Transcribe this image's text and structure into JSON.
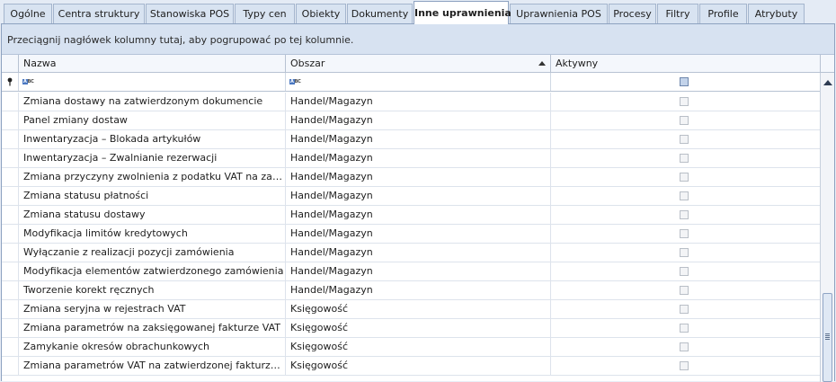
{
  "tabs": [
    {
      "label": "Ogólne",
      "active": false
    },
    {
      "label": "Centra struktury",
      "active": false
    },
    {
      "label": "Stanowiska POS",
      "active": false
    },
    {
      "label": "Typy cen",
      "active": false
    },
    {
      "label": "Obiekty",
      "active": false
    },
    {
      "label": "Dokumenty",
      "active": false
    },
    {
      "label": "Inne uprawnienia",
      "active": true
    },
    {
      "label": "Uprawnienia POS",
      "active": false
    },
    {
      "label": "Procesy",
      "active": false
    },
    {
      "label": "Filtry",
      "active": false
    },
    {
      "label": "Profile",
      "active": false
    },
    {
      "label": "Atrybuty",
      "active": false
    }
  ],
  "group_panel_text": "Przeciągnij nagłówek kolumny tutaj, aby pogrupować po tej kolumnie.",
  "columns": {
    "name": "Nazwa",
    "area": "Obszar",
    "active": "Aktywny"
  },
  "filter_icon_text": "ABC",
  "rows": [
    {
      "name": "Zmiana dostawy na zatwierdzonym dokumencie",
      "area": "Handel/Magazyn",
      "active": false
    },
    {
      "name": "Panel zmiany dostaw",
      "area": "Handel/Magazyn",
      "active": false
    },
    {
      "name": "Inwentaryzacja – Blokada artykułów",
      "area": "Handel/Magazyn",
      "active": false
    },
    {
      "name": "Inwentaryzacja – Zwalnianie rezerwacji",
      "area": "Handel/Magazyn",
      "active": false
    },
    {
      "name": "Zmiana przyczyny zwolnienia z podatku VAT na zatwie…",
      "area": "Handel/Magazyn",
      "active": false
    },
    {
      "name": "Zmiana statusu płatności",
      "area": "Handel/Magazyn",
      "active": false
    },
    {
      "name": "Zmiana statusu dostawy",
      "area": "Handel/Magazyn",
      "active": false
    },
    {
      "name": "Modyfikacja limitów kredytowych",
      "area": "Handel/Magazyn",
      "active": false
    },
    {
      "name": "Wyłączanie z realizacji pozycji zamówienia",
      "area": "Handel/Magazyn",
      "active": false
    },
    {
      "name": "Modyfikacja elementów zatwierdzonego zamówienia",
      "area": "Handel/Magazyn",
      "active": false
    },
    {
      "name": "Tworzenie korekt ręcznych",
      "area": "Handel/Magazyn",
      "active": false
    },
    {
      "name": "Zmiana seryjna w rejestrach VAT",
      "area": "Księgowość",
      "active": false
    },
    {
      "name": "Zmiana parametrów na zaksięgowanej fakturze VAT",
      "area": "Księgowość",
      "active": false
    },
    {
      "name": "Zamykanie okresów obrachunkowych",
      "area": "Księgowość",
      "active": false
    },
    {
      "name": "Zmiana parametrów VAT na zatwierdzonej fakturze VAT",
      "area": "Księgowość",
      "active": false
    }
  ]
}
